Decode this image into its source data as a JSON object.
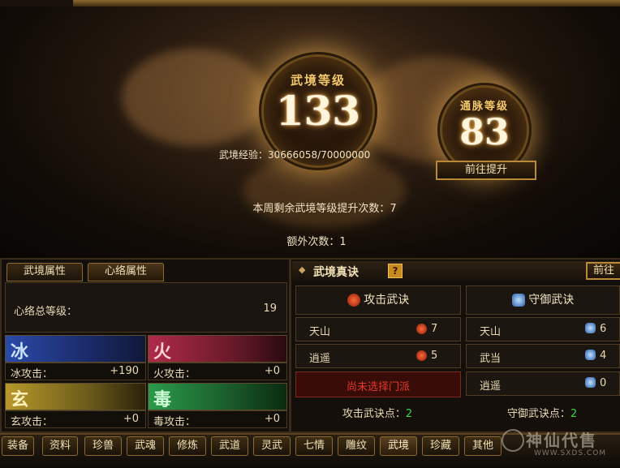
{
  "top": {
    "orb_main_title": "武境等级",
    "orb_main_value": "133",
    "orb_side_title": "通脉等级",
    "orb_side_value": "83",
    "exp_label": "武境经验：",
    "exp_value": "30666058/70000000",
    "goto_button": "前往提升",
    "weekly_label": "本周剩余武境等级提升次数：",
    "weekly_value": "7",
    "extra_label": "额外次数：",
    "extra_value": "1"
  },
  "left": {
    "tabs": [
      "武境属性",
      "心络属性"
    ],
    "total_label": "心络总等级：",
    "total_value": "19",
    "elements": [
      {
        "glyph": "冰",
        "label": "冰攻击：",
        "value": "+190",
        "color": "#2a4aa8"
      },
      {
        "glyph": "火",
        "label": "火攻击：",
        "value": "+0",
        "color": "#a82a4a"
      },
      {
        "glyph": "玄",
        "label": "玄攻击：",
        "value": "+0",
        "color": "#a8882a"
      },
      {
        "glyph": "毒",
        "label": "毒攻击：",
        "value": "+0",
        "color": "#2a8a3a"
      }
    ]
  },
  "right": {
    "title": "武境真诀",
    "help": "?",
    "goto_partial": "前往",
    "attack": {
      "header": "攻击武诀",
      "rows": [
        {
          "name": "天山",
          "value": "7"
        },
        {
          "name": "逍遥",
          "value": "5"
        }
      ],
      "notice": "尚未选择门派",
      "points_label": "攻击武诀点：",
      "points_value": "2"
    },
    "defense": {
      "header": "守御武诀",
      "rows": [
        {
          "name": "天山",
          "value": "6"
        },
        {
          "name": "武当",
          "value": "4"
        },
        {
          "name": "逍遥",
          "value": "0"
        }
      ],
      "points_label": "守御武诀点：",
      "points_value": "2"
    }
  },
  "bottom_tabs": [
    "装备",
    "资料",
    "珍兽",
    "武魂",
    "修炼",
    "武道",
    "灵武",
    "七情",
    "雕纹",
    "武境",
    "珍藏",
    "其他"
  ],
  "watermark": "神仙代售",
  "watermark_url": "WWW.SXDS.COM"
}
